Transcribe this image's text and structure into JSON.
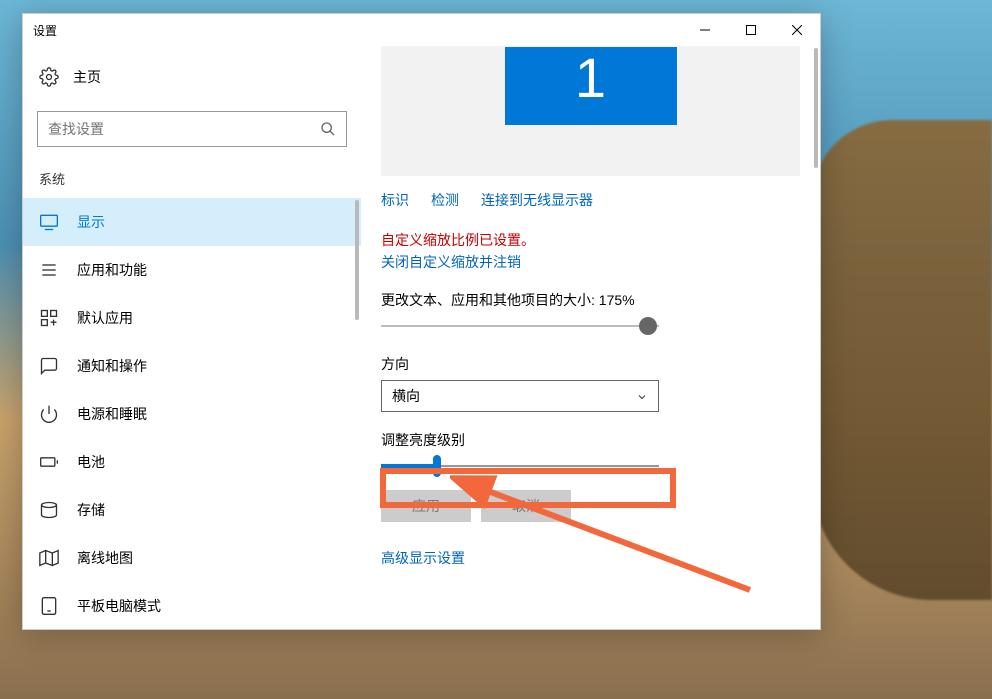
{
  "window": {
    "title": "设置"
  },
  "sidebar": {
    "home": "主页",
    "search_placeholder": "查找设置",
    "section": "系统",
    "items": [
      {
        "label": "显示"
      },
      {
        "label": "应用和功能"
      },
      {
        "label": "默认应用"
      },
      {
        "label": "通知和操作"
      },
      {
        "label": "电源和睡眠"
      },
      {
        "label": "电池"
      },
      {
        "label": "存储"
      },
      {
        "label": "离线地图"
      },
      {
        "label": "平板电脑模式"
      }
    ]
  },
  "content": {
    "monitor_number": "1",
    "links": {
      "identify": "标识",
      "detect": "检测",
      "wireless": "连接到无线显示器"
    },
    "scale_warning": "自定义缩放比例已设置。",
    "scale_reset_link": "关闭自定义缩放并注销",
    "scale_label": "更改文本、应用和其他项目的大小: 175%",
    "orientation_label": "方向",
    "orientation_value": "横向",
    "brightness_label": "调整亮度级别",
    "apply_btn": "应用",
    "cancel_btn": "取消",
    "advanced_link": "高级显示设置"
  }
}
